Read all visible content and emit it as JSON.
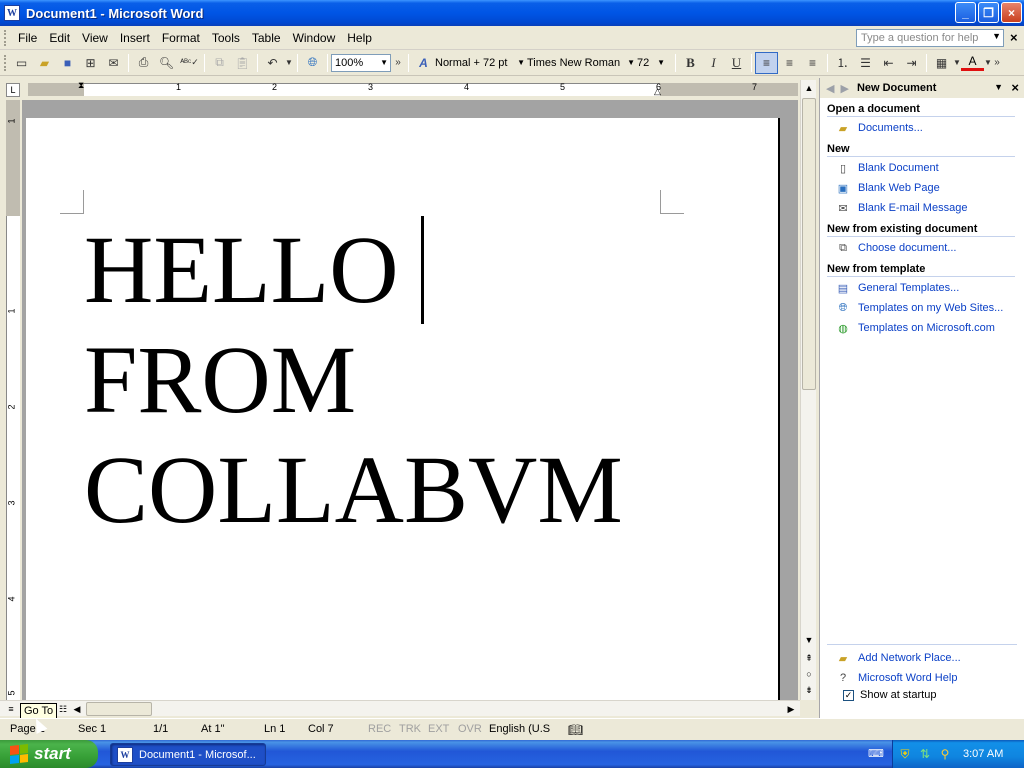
{
  "window": {
    "title": "Document1 - Microsoft Word",
    "app_icon": "W",
    "minimize_icon": "_",
    "restore_icon": "❐",
    "close_icon": "×"
  },
  "menubar": {
    "items": [
      "File",
      "Edit",
      "View",
      "Insert",
      "Format",
      "Tools",
      "Table",
      "Window",
      "Help"
    ],
    "help_placeholder": "Type a question for help",
    "close_icon": "×"
  },
  "toolbar": {
    "zoom": "100%",
    "style": "Normal + 72 pt",
    "font": "Times New Roman",
    "size": "72",
    "bold": "B",
    "italic": "I",
    "underline": "U",
    "font_color_label": "A"
  },
  "ruler": {
    "numbers": [
      "1",
      "2",
      "3",
      "4",
      "5",
      "6",
      "7"
    ],
    "vertical_numbers": [
      "1",
      "1",
      "2",
      "3",
      "4",
      "5"
    ]
  },
  "document": {
    "lines": [
      "HELLO",
      "FROM",
      "COLLABVM"
    ]
  },
  "tooltip": "Go To",
  "statusbar": {
    "page": "Page 1",
    "sec": "Sec 1",
    "pages": "1/1",
    "at": "At 1\"",
    "ln": "Ln 1",
    "col": "Col 7",
    "rec": "REC",
    "trk": "TRK",
    "ext": "EXT",
    "ovr": "OVR",
    "language": "English (U.S"
  },
  "taskpane": {
    "title": "New Document",
    "sections": {
      "open": "Open a document",
      "new": "New",
      "existing": "New from existing document",
      "template": "New from template"
    },
    "links": {
      "documents": "Documents...",
      "blank_document": "Blank Document",
      "blank_web_page": "Blank Web Page",
      "blank_email": "Blank E-mail Message",
      "choose_document": "Choose document...",
      "general_templates": "General Templates...",
      "templates_web": "Templates on my Web Sites...",
      "templates_ms": "Templates on Microsoft.com",
      "add_network": "Add Network Place...",
      "word_help": "Microsoft Word Help"
    },
    "show_startup": "Show at startup",
    "show_startup_checked": true
  },
  "taskbar": {
    "start": "start",
    "task_button": "Document1 - Microsof...",
    "time": "3:07 AM"
  }
}
